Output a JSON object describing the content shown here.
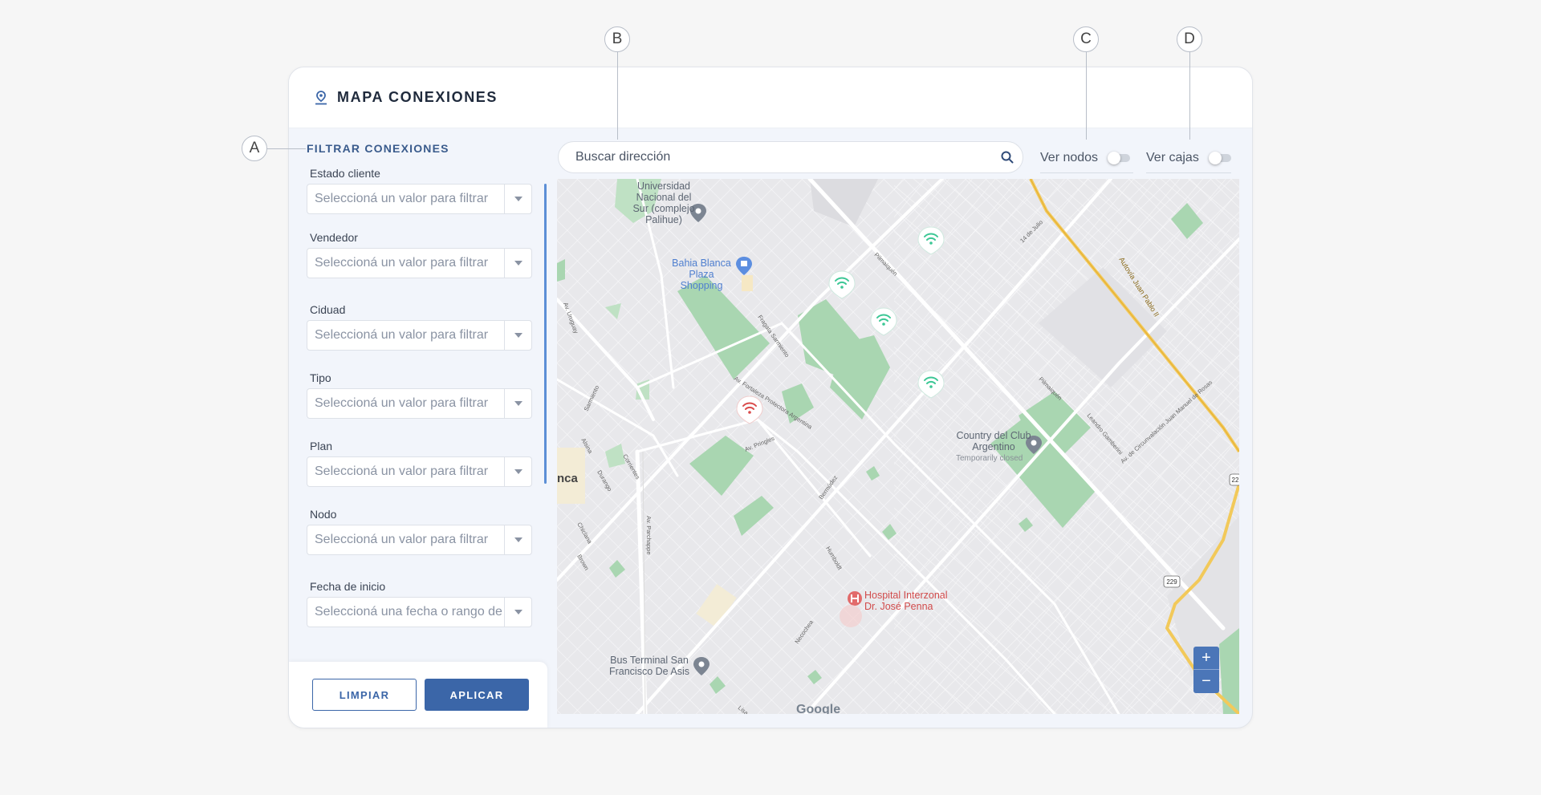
{
  "callouts": {
    "a": "A",
    "b": "B",
    "c": "C",
    "d": "D"
  },
  "header": {
    "title": "MAPA CONEXIONES",
    "icon": "map-pin-icon"
  },
  "sidebar": {
    "title": "FILTRAR CONEXIONES",
    "filters": [
      {
        "label": "Estado cliente",
        "placeholder": "Seleccioná un valor para filtrar"
      },
      {
        "label": "Vendedor",
        "placeholder": "Seleccioná un valor para filtrar"
      },
      {
        "label": "Ciduad",
        "placeholder": "Seleccioná un valor para filtrar"
      },
      {
        "label": "Tipo",
        "placeholder": "Seleccioná un valor para filtrar"
      },
      {
        "label": "Plan",
        "placeholder": "Seleccioná un valor para filtrar"
      },
      {
        "label": "Nodo",
        "placeholder": "Seleccioná un valor para filtrar"
      },
      {
        "label": "Fecha de inicio",
        "placeholder": "Seleccioná una fecha o rango de"
      }
    ],
    "clear_label": "LIMPIAR",
    "apply_label": "APLICAR"
  },
  "search": {
    "placeholder": "Buscar dirección"
  },
  "toggles": {
    "nodes_label": "Ver nodos",
    "nodes_on": false,
    "boxes_label": "Ver cajas",
    "boxes_on": false
  },
  "map": {
    "labels": {
      "university": "Universidad Nacional del Sur (complejo Palihue)",
      "mall": "Bahia Blanca Plaza Shopping",
      "club": "Country del Club Argentino",
      "club_status": "Temporarily closed",
      "hospital": "Hospital Interzonal Dr. José Penna",
      "terminal": "Bus Terminal San Francisco De Asis",
      "city_fragment": "nca",
      "highway": "Autovía Juan Pablo II",
      "route_shield": "229",
      "route_shield_2": "22",
      "watermark": "Google"
    },
    "zoom_in": "+",
    "zoom_out": "−",
    "colors": {
      "connected": "#3cc795",
      "disconnected": "#d94b4b",
      "accent": "#3b66a8"
    }
  }
}
